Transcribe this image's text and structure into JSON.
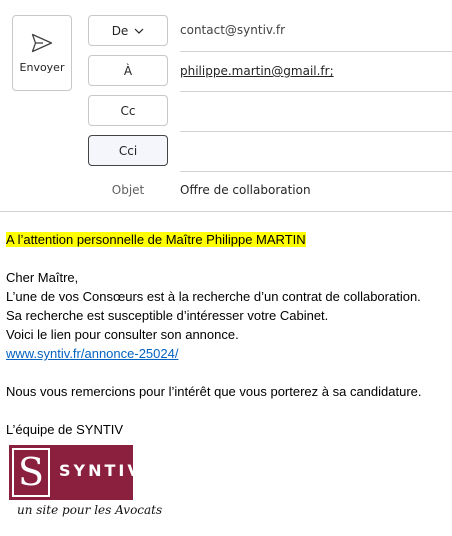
{
  "toolbar": {
    "send_label": "Envoyer",
    "send_icon": "send-icon"
  },
  "header": {
    "from_label": "De",
    "from_value": "contact@syntiv.fr",
    "to_label": "À",
    "to_value": "philippe.martin@gmail.fr;",
    "cc_label": "Cc",
    "cc_value": "",
    "bcc_label": "Cci",
    "bcc_value": "",
    "subject_label": "Objet",
    "subject_value": "Offre de collaboration"
  },
  "body": {
    "attention_line": "A l’attention personnelle de Maître Philippe MARTIN",
    "greeting": "Cher Maître,",
    "line1": "L’une de vos Consœurs est à la recherche d’un contrat de collaboration.",
    "line2": "Sa recherche est susceptible d’intéresser votre Cabinet.",
    "line3": "Voici le lien pour consulter son  annonce.",
    "link_text": "www.syntiv.fr/annonce-25024/",
    "thanks": "Nous vous remercions pour l’intérêt que vous porterez à sa candidature.",
    "signature": "L’équipe de SYNTIV"
  },
  "logo": {
    "letter": "S",
    "name": "SYNTIV",
    "tagline": "un site pour les Avocats",
    "brand_color": "#8b1f3e"
  },
  "colors": {
    "highlight": "#ffff00",
    "link": "#0563c1",
    "border": "#c8c8c8"
  }
}
